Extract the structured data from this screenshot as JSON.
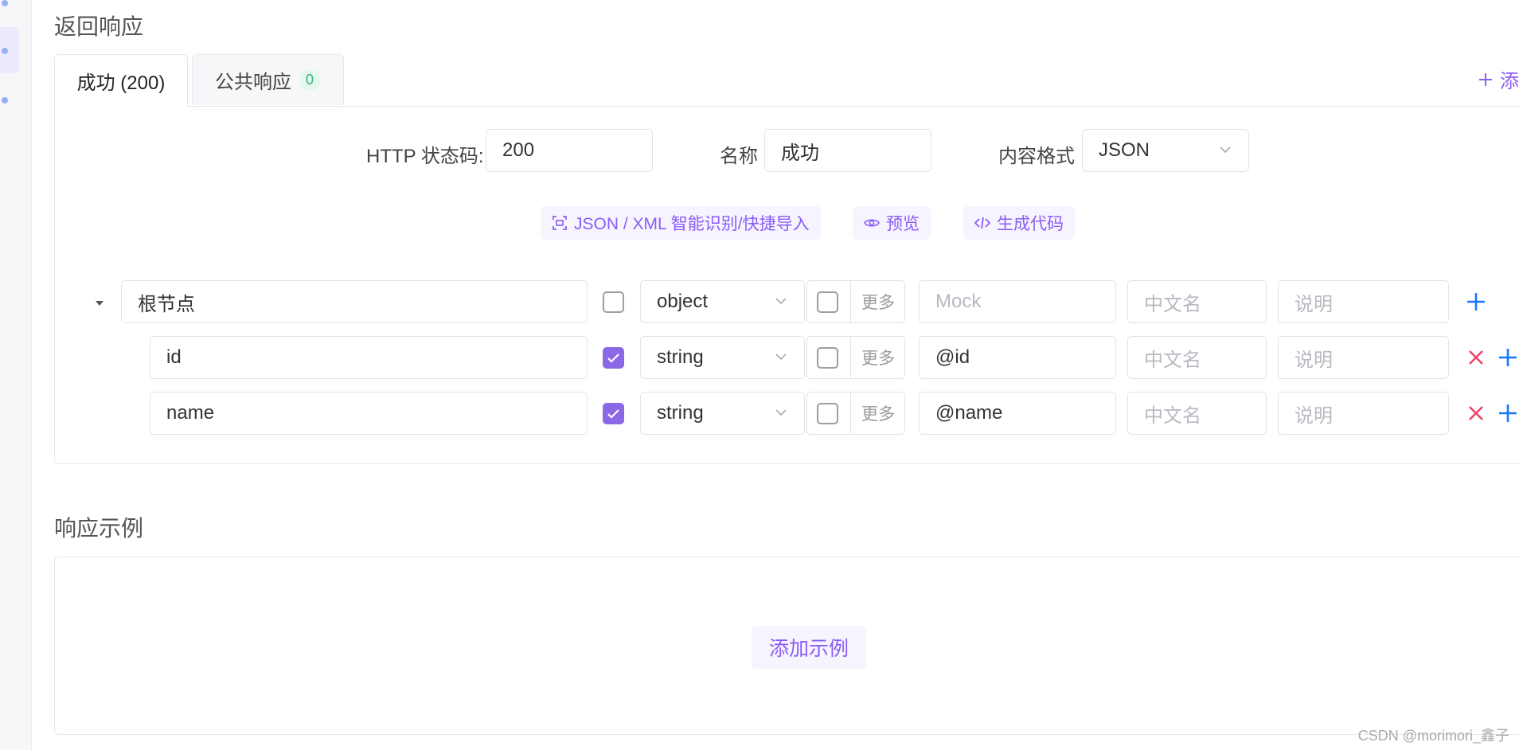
{
  "sections": {
    "response_title": "返回响应",
    "example_title": "响应示例"
  },
  "tabs": [
    {
      "label": "成功 (200)"
    },
    {
      "label": "公共响应",
      "badge": "0"
    }
  ],
  "add_tab_label": "添",
  "form": {
    "status_label": "HTTP 状态码:",
    "status_value": "200",
    "name_label": "名称",
    "name_value": "成功",
    "format_label": "内容格式",
    "format_value": "JSON"
  },
  "toolbar": {
    "import_label": "JSON / XML 智能识别/快捷导入",
    "preview_label": "预览",
    "codegen_label": "生成代码"
  },
  "schema": {
    "more_label": "更多",
    "rows": [
      {
        "name": "根节点",
        "required": false,
        "type": "object",
        "mock": "",
        "mock_placeholder": "Mock",
        "cn_placeholder": "中文名",
        "desc_placeholder": "说明"
      },
      {
        "name": "id",
        "required": true,
        "type": "string",
        "mock": "@id",
        "cn_placeholder": "中文名",
        "desc_placeholder": "说明"
      },
      {
        "name": "name",
        "required": true,
        "type": "string",
        "mock": "@name",
        "cn_placeholder": "中文名",
        "desc_placeholder": "说明"
      }
    ]
  },
  "example": {
    "add_label": "添加示例"
  },
  "watermark": "CSDN @morimori_鑫子",
  "colors": {
    "accent": "#8b5cf6",
    "checked": "#8b68e6",
    "add_blue": "#1677ff",
    "delete_red": "#f0436a",
    "badge_green": "#2fb87a"
  },
  "icons": [
    "caret-down-icon",
    "chevron-down-icon",
    "scan-icon",
    "eye-icon",
    "code-icon",
    "plus-icon",
    "close-icon",
    "check-icon"
  ]
}
